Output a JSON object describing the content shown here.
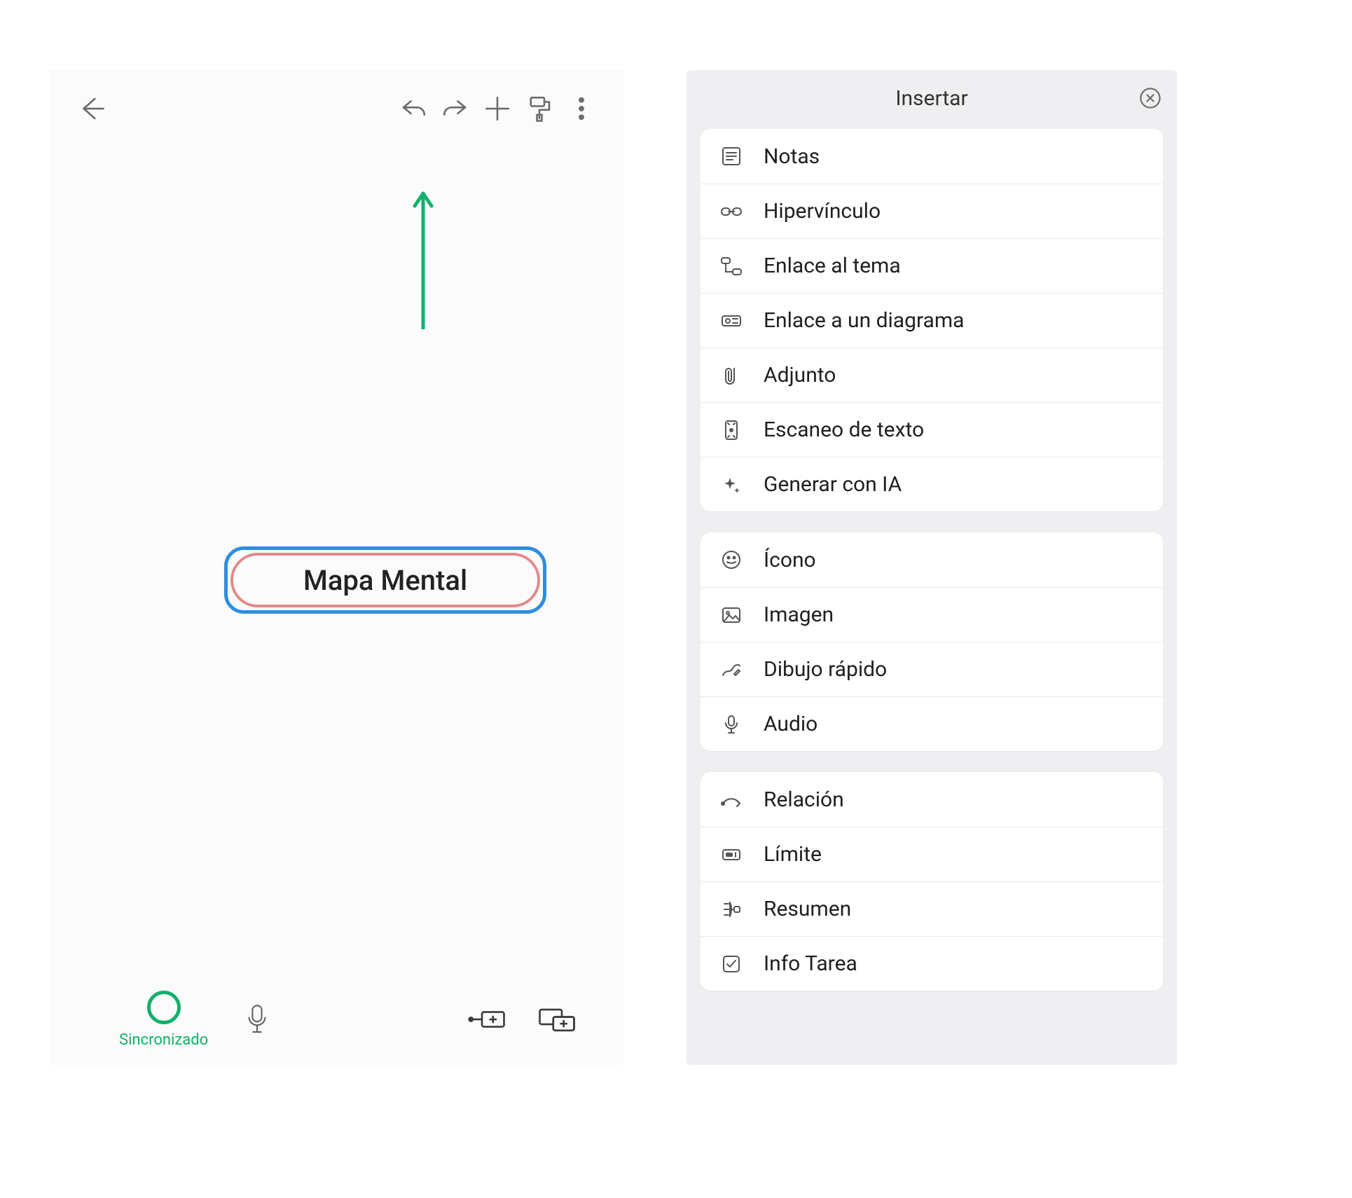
{
  "toolbar": {
    "icons": {
      "back": "back-arrow-icon",
      "undo": "undo-icon",
      "redo": "redo-icon",
      "add": "plus-icon",
      "format": "format-roller-icon",
      "more": "more-vertical-icon"
    }
  },
  "node": {
    "label": "Mapa Mental"
  },
  "sync": {
    "label": "Sincronizado"
  },
  "panel": {
    "title": "Insertar",
    "groups": [
      [
        {
          "icon": "notes-icon",
          "label": "Notas"
        },
        {
          "icon": "hyperlink-icon",
          "label": "Hipervínculo"
        },
        {
          "icon": "topic-link-icon",
          "label": "Enlace al tema"
        },
        {
          "icon": "diagram-link-icon",
          "label": "Enlace a un diagrama"
        },
        {
          "icon": "attachment-icon",
          "label": "Adjunto"
        },
        {
          "icon": "scan-text-icon",
          "label": "Escaneo de texto"
        },
        {
          "icon": "ai-sparkles-icon",
          "label": "Generar con IA"
        }
      ],
      [
        {
          "icon": "emoji-icon",
          "label": "Ícono"
        },
        {
          "icon": "image-icon",
          "label": "Imagen"
        },
        {
          "icon": "sketch-icon",
          "label": "Dibujo rápido"
        },
        {
          "icon": "audio-mic-icon",
          "label": "Audio"
        }
      ],
      [
        {
          "icon": "relationship-icon",
          "label": "Relación"
        },
        {
          "icon": "boundary-icon",
          "label": "Límite"
        },
        {
          "icon": "summary-icon",
          "label": "Resumen"
        },
        {
          "icon": "task-info-icon",
          "label": "Info Tarea"
        }
      ]
    ]
  },
  "hint": {
    "arrow_color": "#13b06b"
  }
}
